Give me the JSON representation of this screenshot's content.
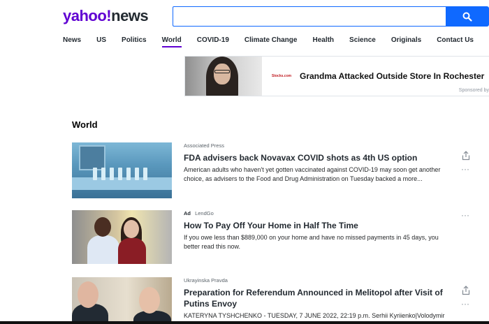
{
  "logo": {
    "brand": "yahoo!",
    "product": "news"
  },
  "search": {
    "value": "",
    "placeholder": ""
  },
  "nav": {
    "items": [
      {
        "label": "News"
      },
      {
        "label": "US"
      },
      {
        "label": "Politics"
      },
      {
        "label": "World",
        "active": true
      },
      {
        "label": "COVID-19"
      },
      {
        "label": "Climate Change"
      },
      {
        "label": "Health"
      },
      {
        "label": "Science"
      },
      {
        "label": "Originals"
      },
      {
        "label": "Contact Us"
      }
    ]
  },
  "ad_banner": {
    "brand": "Stocks.com",
    "headline": "Grandma Attacked Outside Store In Rochester",
    "sponsored": "Sponsored by"
  },
  "section": {
    "title": "World"
  },
  "stories": [
    {
      "provider": "Associated Press",
      "ad_label": "",
      "headline": "FDA advisers back Novavax COVID shots as 4th US option",
      "summary": "American adults who haven't yet gotten vaccinated against COVID-19 may soon get another choice, as advisers to the Food and Drug Administration on Tuesday backed a more..."
    },
    {
      "provider": "LendGo",
      "ad_label": "Ad",
      "headline": "How To Pay Off Your Home in Half The Time",
      "summary": "If you owe less than $889,000 on your home and have no missed payments in 45 days, you better read this now."
    },
    {
      "provider": "Ukrayinska Pravda",
      "ad_label": "",
      "headline": "Preparation for Referendum Announced in Melitopol after Visit of Putins Envoy",
      "summary": "KATERYNA TYSHCHENKO - TUESDAY, 7 JUNE 2022, 22:19 p.m. Serhii Kyriienko|Volodymir"
    }
  ],
  "colors": {
    "brand_purple": "#6001d2",
    "search_blue": "#0f69ff"
  }
}
